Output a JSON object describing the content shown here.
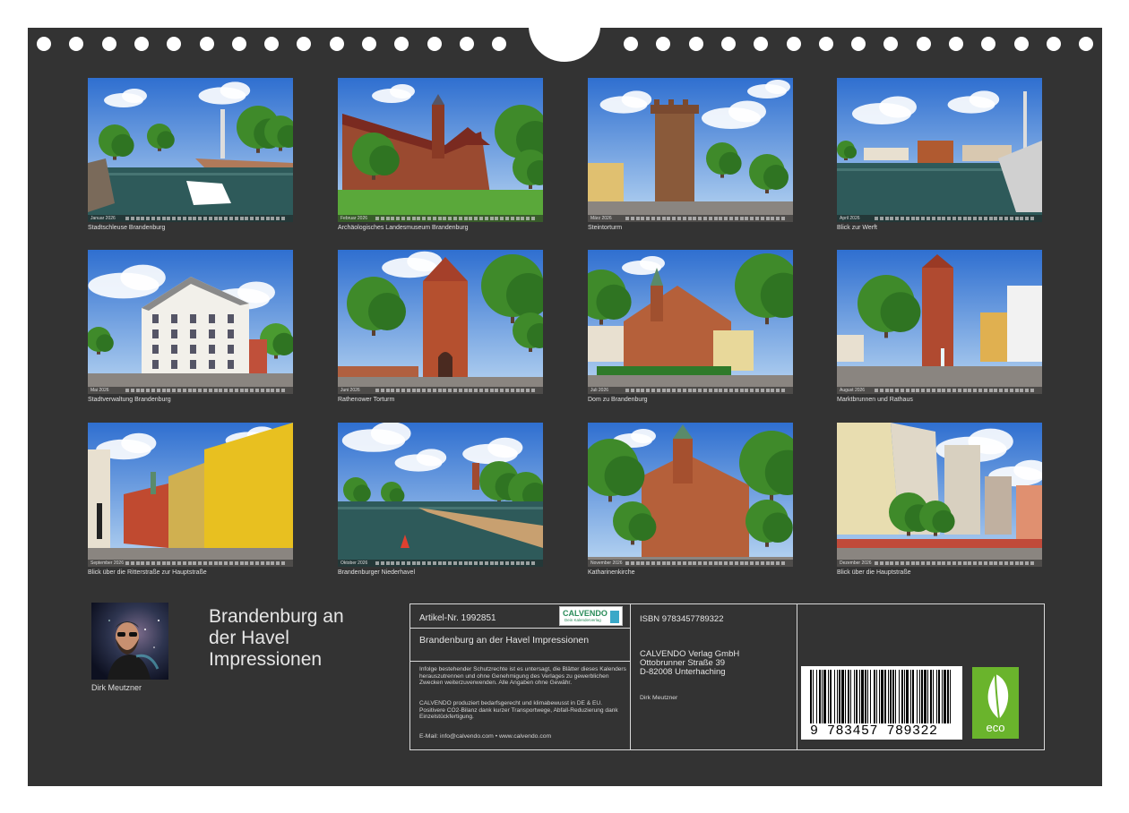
{
  "photos": [
    {
      "caption": "Stadtschleuse Brandenburg",
      "month": "Januar 2026"
    },
    {
      "caption": "Archäologisches Landesmuseum Brandenburg",
      "month": "Februar 2026"
    },
    {
      "caption": "Steintorturm",
      "month": "März 2026"
    },
    {
      "caption": "Blick zur Werft",
      "month": "April 2026"
    },
    {
      "caption": "Stadtverwaltung Brandenburg",
      "month": "Mai 2026"
    },
    {
      "caption": "Rathenower Torturm",
      "month": "Juni 2026"
    },
    {
      "caption": "Dom zu Brandenburg",
      "month": "Juli 2026"
    },
    {
      "caption": "Marktbrunnen und Rathaus",
      "month": "August 2026"
    },
    {
      "caption": "Blick über die Ritterstraße zur Hauptstraße",
      "month": "September 2026"
    },
    {
      "caption": "Brandenburger Niederhavel",
      "month": "Oktober 2026"
    },
    {
      "caption": "Katharinenkirche",
      "month": "November 2026"
    },
    {
      "caption": "Blick über die Hauptstraße",
      "month": "Dezember 2026"
    }
  ],
  "author": {
    "name": "Dirk Meutzner"
  },
  "title": {
    "line1": "Brandenburg an",
    "line2": "der Havel",
    "line3": "Impressionen"
  },
  "info": {
    "article": "Artikel-Nr. 1992851",
    "logo": "CALVENDO",
    "logo_sub": "Dein Kalenderverlag",
    "product_title": "Brandenburg an der Havel Impressionen",
    "legal": "Infolge bestehender Schutzrechte ist es untersagt, die Blätter dieses Kalenders herauszutrennen und ohne Genehmigung des Verlages zu gewerblichen Zwecken weiterzuverwenden. Alle Angaben ohne Gewähr.",
    "eco_text": "CALVENDO produziert bedarfsgerecht und klimabewusst in DE & EU. Positivere CO2-Bilanz dank kurzer Transportwege, Abfall-Reduzierung dank Einzelstückfertigung.",
    "contact": "E-Mail: info@calvendo.com • www.calvendo.com",
    "isbn": "ISBN 9783457789322",
    "publisher_name": "CALVENDO Verlag GmbH",
    "publisher_street": "Ottobrunner Straße 39",
    "publisher_city": "D-82008 Unterhaching",
    "publisher_author": "Dirk Meutzner",
    "barcode_digits": "9 783457 789322",
    "eco_label": "eco"
  }
}
